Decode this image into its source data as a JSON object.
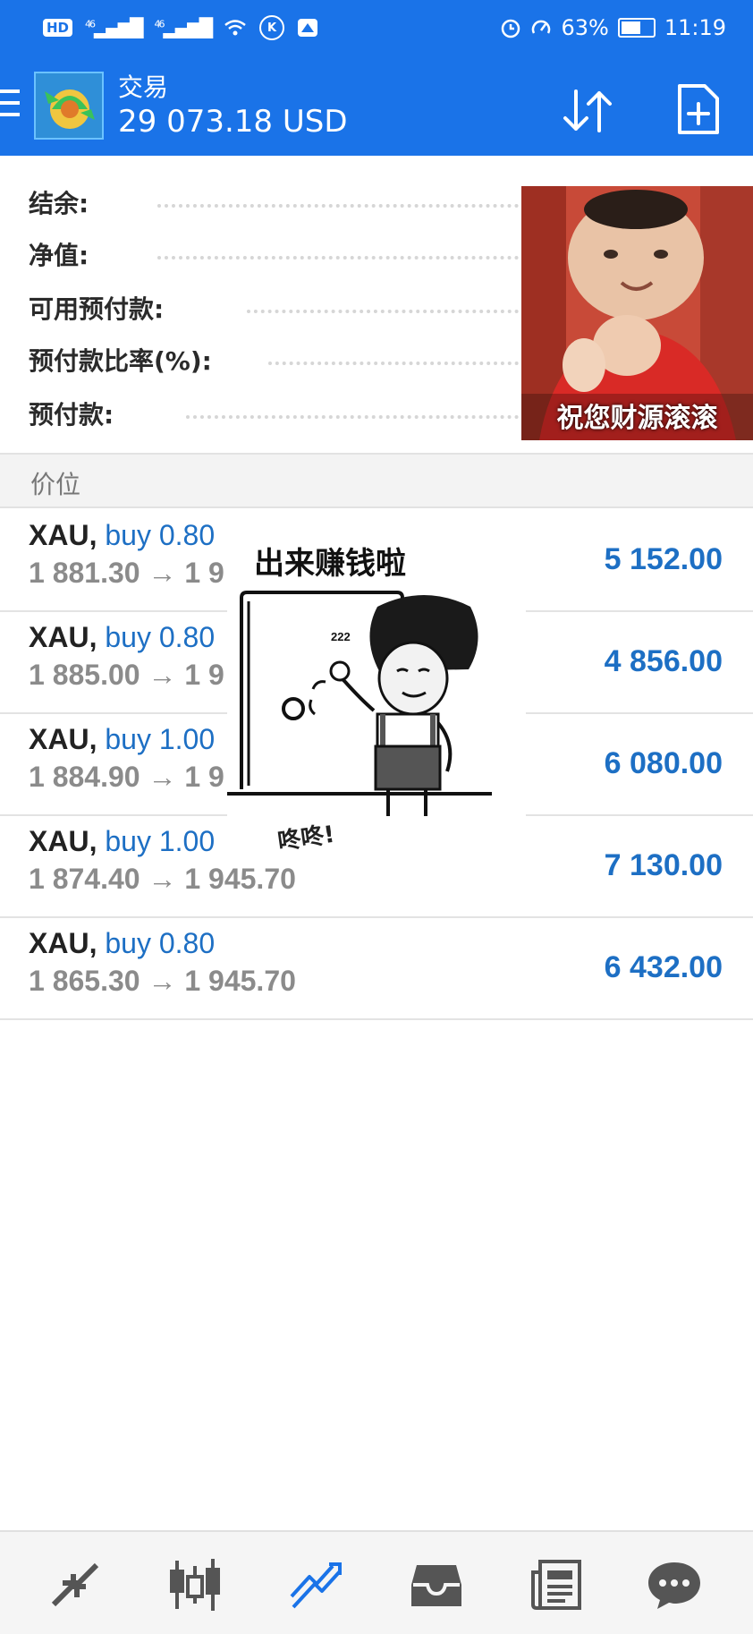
{
  "status_bar": {
    "hd_label": "HD",
    "network_1": "46",
    "network_2": "46",
    "vpn_label": "K",
    "battery_text": "63%",
    "battery_level": 0.63,
    "time": "11:19"
  },
  "app_bar": {
    "title": "交易",
    "balance": "29 073.18 USD"
  },
  "summary": {
    "items": [
      {
        "label": "结余:"
      },
      {
        "label": "净值:"
      },
      {
        "label": "可用预付款:"
      },
      {
        "label": "预付款比率(%):"
      },
      {
        "label": "预付款:"
      }
    ]
  },
  "meme_top": {
    "caption": "祝您财源滚滚"
  },
  "meme_middle": {
    "caption": "出来赚钱啦",
    "door_number": "222",
    "sound_text": "咚咚!"
  },
  "positions_section": {
    "title": "价位"
  },
  "positions": [
    {
      "symbol": "XAU,",
      "side": "buy",
      "volume": "0.80",
      "prices": "1 881.30 → 1 9",
      "profit": "5 152.00"
    },
    {
      "symbol": "XAU,",
      "side": "buy",
      "volume": "0.80",
      "prices": "1 885.00 → 1 9",
      "profit": "4 856.00"
    },
    {
      "symbol": "XAU,",
      "side": "buy",
      "volume": "1.00",
      "prices": "1 884.90 → 1 9",
      "profit": "6 080.00"
    },
    {
      "symbol": "XAU,",
      "side": "buy",
      "volume": "1.00",
      "prices": "1 874.40 → 1 945.70",
      "profit": "7 130.00"
    },
    {
      "symbol": "XAU,",
      "side": "buy",
      "volume": "0.80",
      "prices": "1 865.30 → 1 945.70",
      "profit": "6 432.00"
    }
  ],
  "bottom_nav": {
    "items": [
      {
        "icon": "quotes-arrows-icon"
      },
      {
        "icon": "candlestick-chart-icon"
      },
      {
        "icon": "trade-chart-icon",
        "active": true
      },
      {
        "icon": "inbox-icon"
      },
      {
        "icon": "news-icon"
      },
      {
        "icon": "chat-icon"
      }
    ]
  },
  "colors": {
    "primary": "#1a73e8",
    "profit": "#1d6fc4",
    "active_nav": "#1a73e8",
    "inactive_nav": "#555555"
  }
}
